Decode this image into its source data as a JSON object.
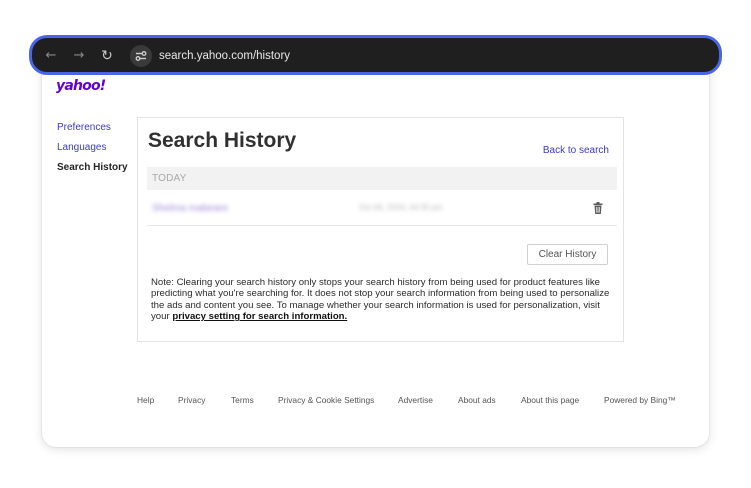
{
  "browser": {
    "url": "search.yahoo.com/history",
    "icons": {
      "back": "back-arrow-icon",
      "forward": "forward-arrow-icon",
      "reload": "reload-icon",
      "site_info": "site-info-icon"
    },
    "colors": {
      "bar": "#1f1f1f",
      "focus_ring": "#4a66e8"
    }
  },
  "logo": {
    "text": "yahoo!",
    "color": "#5f01d1"
  },
  "sidebar": {
    "items": [
      {
        "label": "Preferences",
        "active": false
      },
      {
        "label": "Languages",
        "active": false
      },
      {
        "label": "Search History",
        "active": true
      }
    ]
  },
  "main": {
    "title": "Search History",
    "back_link": "Back to search",
    "section_label": "TODAY",
    "history": [
      {
        "query": "Shelma mabeare",
        "time": "Oct 06, 2024, 04:35 pm",
        "delete_icon": "trash-icon"
      }
    ],
    "clear_button": "Clear History",
    "note_text": "Note: Clearing your search history only stops your search history from being used for product features like predicting what you're searching for. It does not stop your search information from being used to personalize the ads and content you see. To manage whether your search information is used for personalization, visit your ",
    "note_link": "privacy setting for search information."
  },
  "footer": {
    "links": [
      "Help",
      "Privacy",
      "Terms",
      "Privacy & Cookie Settings",
      "Advertise",
      "About ads",
      "About this page",
      "Powered by Bing™"
    ]
  }
}
